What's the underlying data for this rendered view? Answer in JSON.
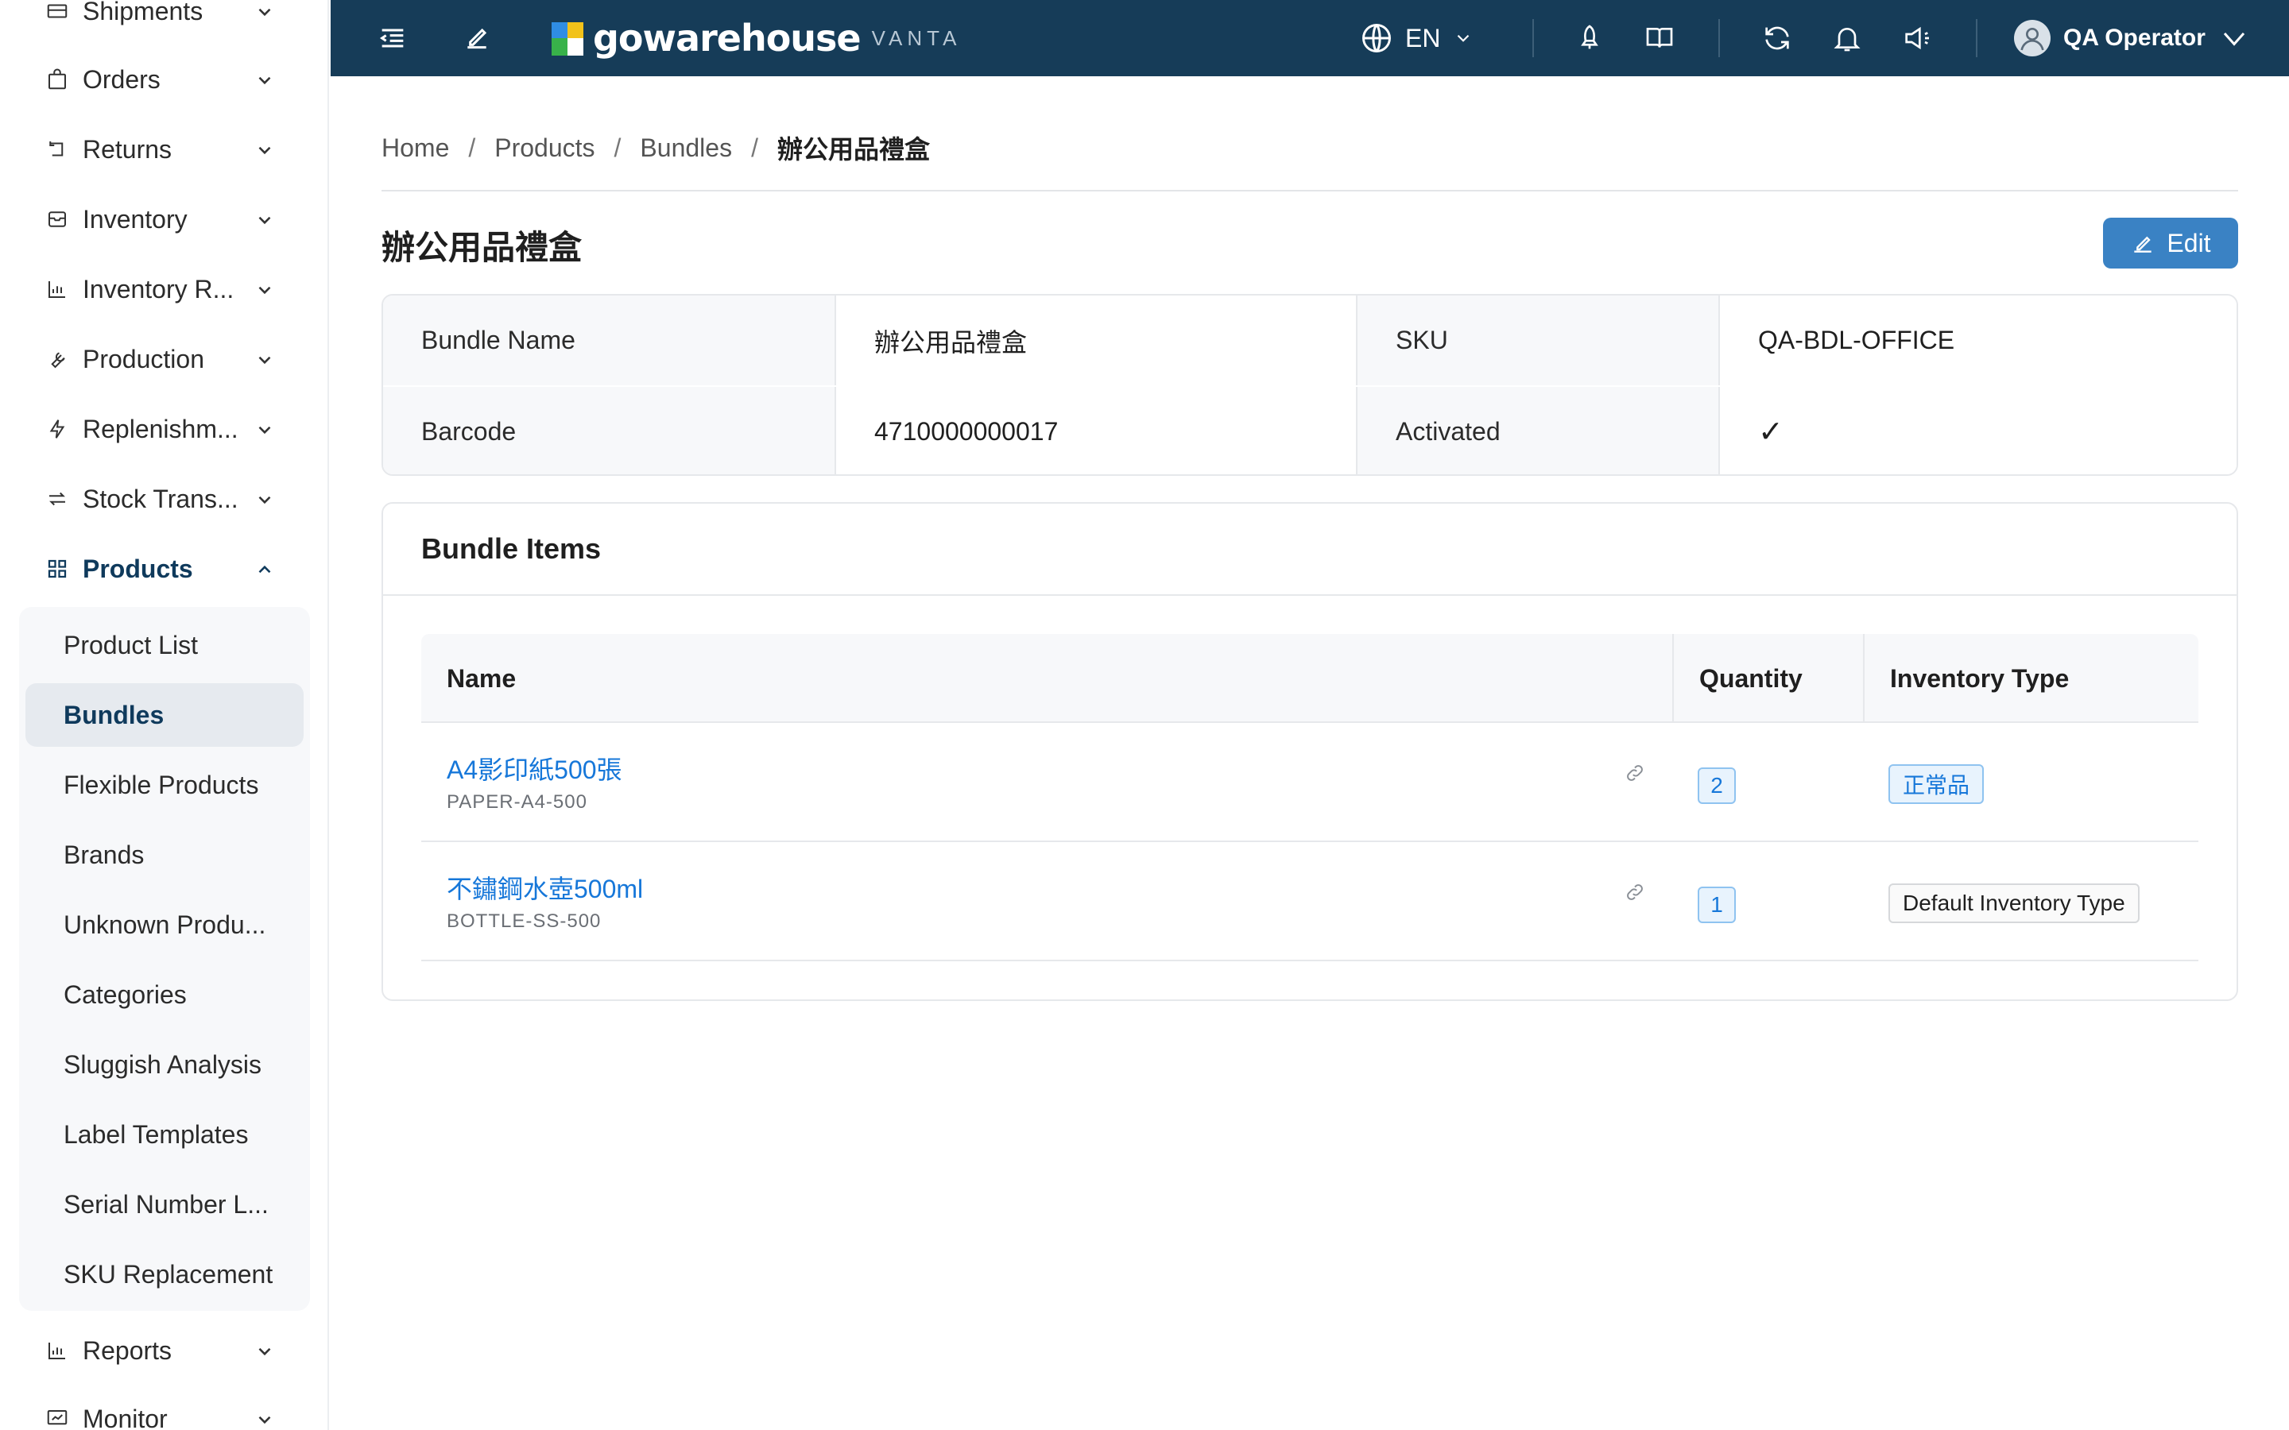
{
  "sidebar": {
    "items": [
      {
        "label": "Shipments",
        "icon": "truck-icon"
      },
      {
        "label": "Orders",
        "icon": "bag-icon"
      },
      {
        "label": "Returns",
        "icon": "return-icon"
      },
      {
        "label": "Inventory",
        "icon": "box-icon"
      },
      {
        "label": "Inventory R...",
        "icon": "bar-chart-icon"
      },
      {
        "label": "Production",
        "icon": "wrench-icon"
      },
      {
        "label": "Replenishm...",
        "icon": "bolt-icon"
      },
      {
        "label": "Stock Trans...",
        "icon": "transfer-icon"
      },
      {
        "label": "Products",
        "icon": "grid-icon"
      },
      {
        "label": "Reports",
        "icon": "bar-chart-icon"
      },
      {
        "label": "Monitor",
        "icon": "monitor-icon"
      }
    ],
    "products_sub": [
      {
        "label": "Product List"
      },
      {
        "label": "Bundles"
      },
      {
        "label": "Flexible Products"
      },
      {
        "label": "Brands"
      },
      {
        "label": "Unknown Produ..."
      },
      {
        "label": "Categories"
      },
      {
        "label": "Sluggish Analysis"
      },
      {
        "label": "Label Templates"
      },
      {
        "label": "Serial Number L..."
      },
      {
        "label": "SKU Replacement"
      }
    ]
  },
  "topbar": {
    "brand_name": "gowarehouse",
    "brand_sub": "VANTA",
    "language": "EN",
    "user_name": "QA Operator",
    "colors": {
      "bar": "#163c58",
      "accent": "#3a82c4"
    }
  },
  "breadcrumb": {
    "home": "Home",
    "products": "Products",
    "bundles": "Bundles",
    "current": "辦公用品禮盒",
    "separator": "/"
  },
  "page": {
    "title": "辦公用品禮盒",
    "edit_label": "Edit"
  },
  "details": {
    "bundle_name_label": "Bundle Name",
    "bundle_name_value": "辦公用品禮盒",
    "sku_label": "SKU",
    "sku_value": "QA-BDL-OFFICE",
    "barcode_label": "Barcode",
    "barcode_value": "4710000000017",
    "activated_label": "Activated",
    "activated_value": "✓"
  },
  "bundle_items": {
    "title": "Bundle Items",
    "columns": {
      "name": "Name",
      "quantity": "Quantity",
      "inventory_type": "Inventory Type"
    },
    "rows": [
      {
        "name": "A4影印紙500張",
        "sku": "PAPER-A4-500",
        "quantity": "2",
        "inventory_type": "正常品"
      },
      {
        "name": "不鏽鋼水壺500ml",
        "sku": "BOTTLE-SS-500",
        "quantity": "1",
        "inventory_type": "Default Inventory Type"
      }
    ]
  }
}
